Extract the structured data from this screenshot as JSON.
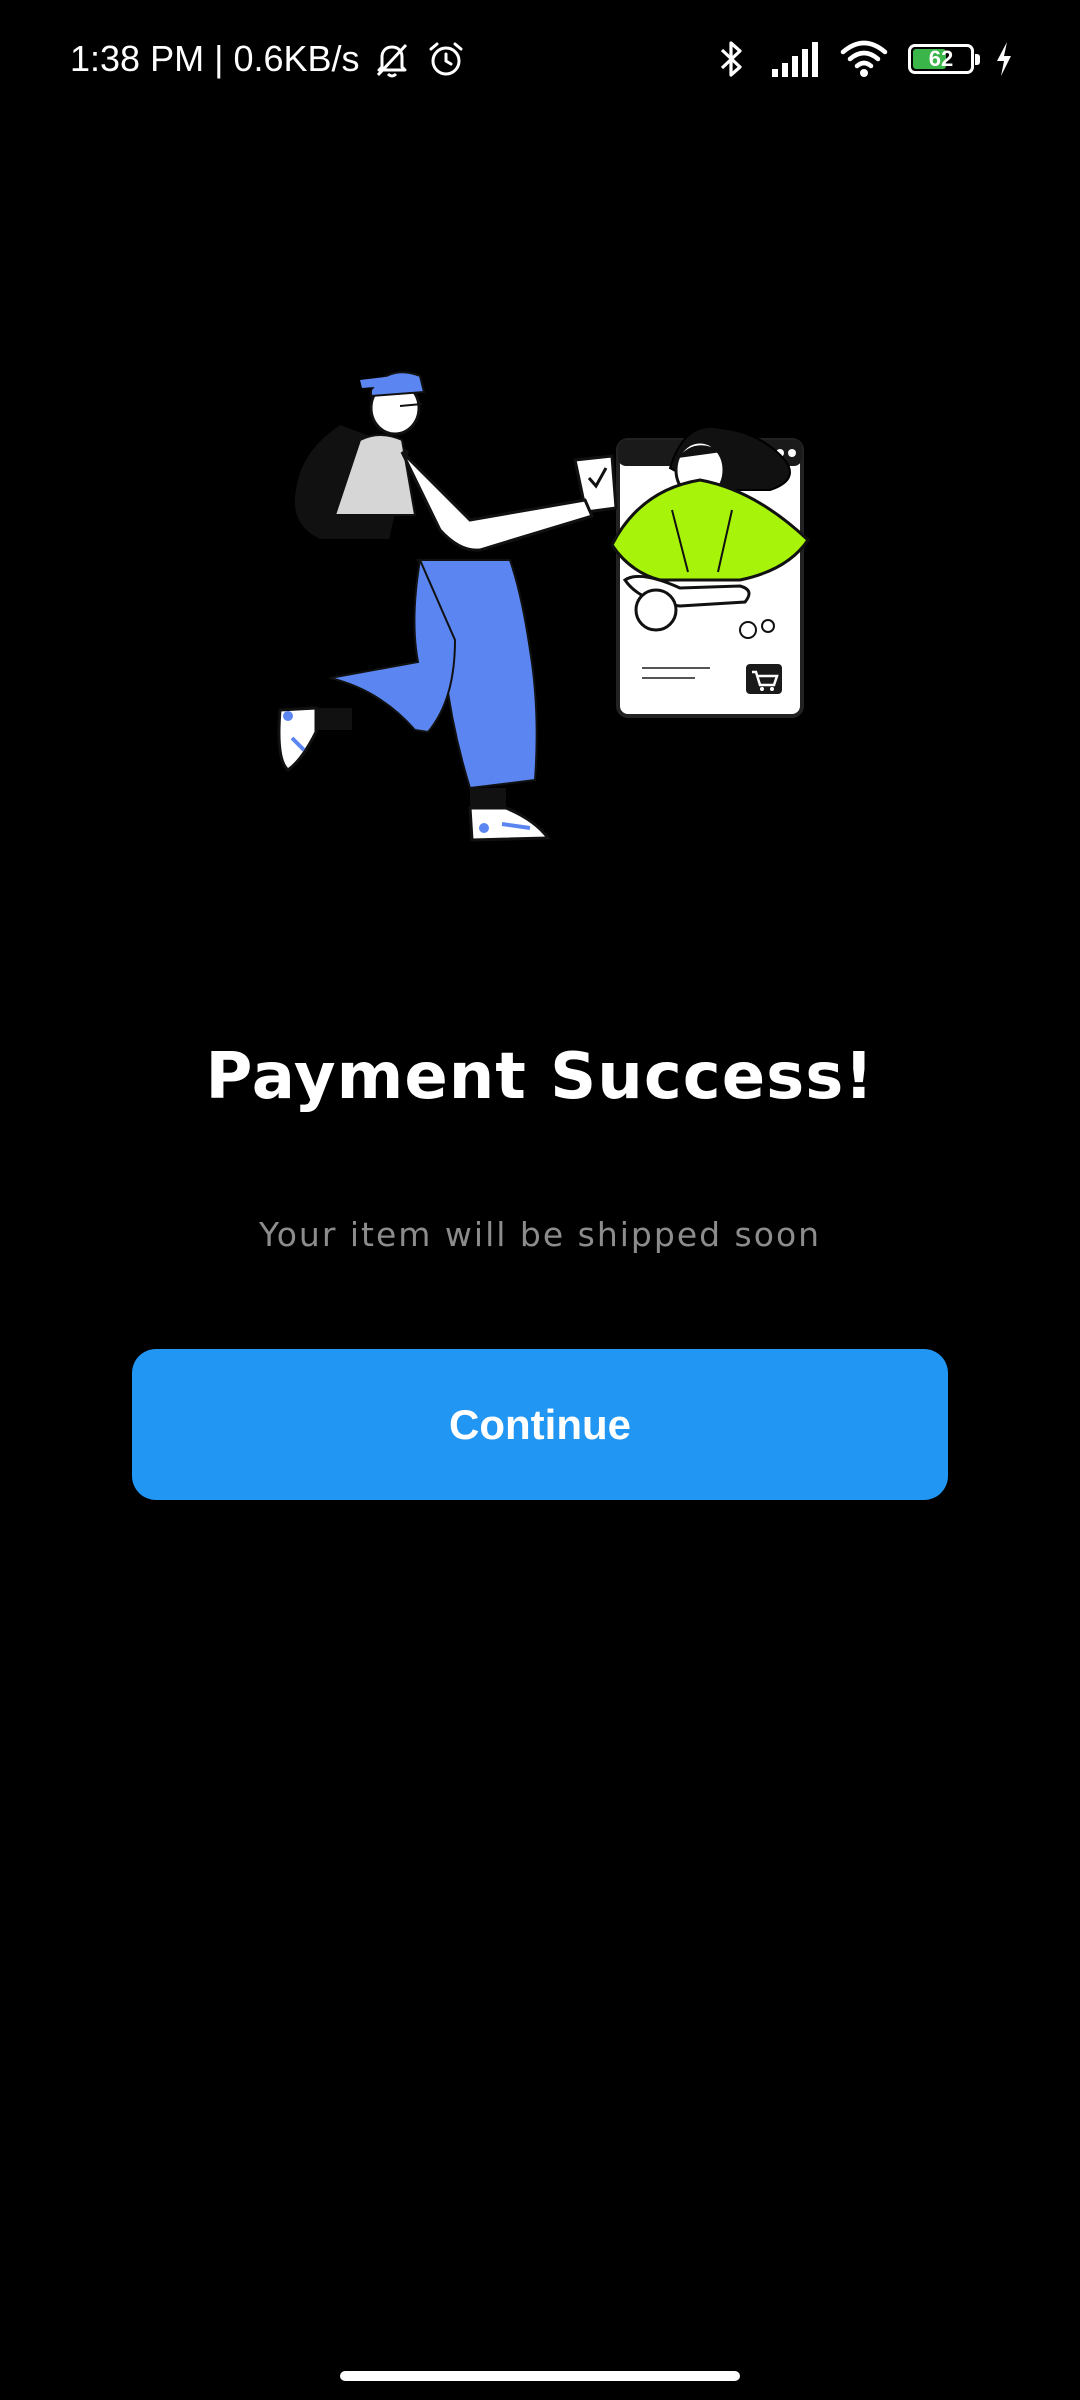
{
  "status_bar": {
    "time": "1:38 PM",
    "separator": "|",
    "network_speed": "0.6KB/s",
    "battery_level": "62",
    "battery_fraction": 0.62,
    "icons": [
      "mute-bell-icon",
      "alarm-icon",
      "bluetooth-icon",
      "signal-icon",
      "wifi-icon",
      "battery-icon",
      "charging-icon"
    ]
  },
  "illustration": {
    "icon": "payment-success-illustration",
    "colors": {
      "accent_blue": "#5b86f2",
      "accent_lime": "#a7f40a",
      "shirt_gray": "#d6d6d6"
    }
  },
  "main": {
    "title": "Payment Success!",
    "subtitle": "Your item will be shipped soon"
  },
  "actions": {
    "continue_label": "Continue",
    "color": "#2196f3"
  }
}
